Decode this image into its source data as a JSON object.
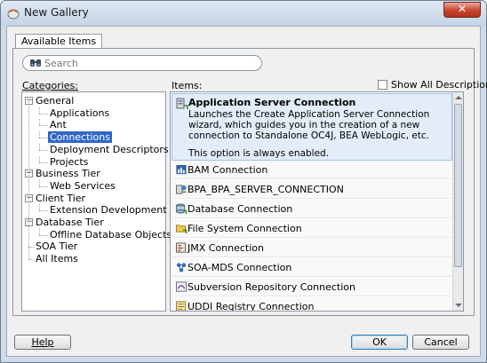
{
  "window": {
    "title": "New Gallery",
    "close_label": "✕"
  },
  "tabs": [
    {
      "label": "Available Items"
    }
  ],
  "search": {
    "placeholder": "Search",
    "value": ""
  },
  "categories": {
    "label": "Categories:",
    "tree": [
      {
        "label": "General",
        "level": 0,
        "expander": "−"
      },
      {
        "label": "Applications",
        "level": 1
      },
      {
        "label": "Ant",
        "level": 1
      },
      {
        "label": "Connections",
        "level": 1,
        "selected": true
      },
      {
        "label": "Deployment Descriptors",
        "level": 1
      },
      {
        "label": "Projects",
        "level": 1
      },
      {
        "label": "Business Tier",
        "level": 0,
        "expander": "−"
      },
      {
        "label": "Web Services",
        "level": 1
      },
      {
        "label": "Client Tier",
        "level": 0,
        "expander": "−"
      },
      {
        "label": "Extension Development",
        "level": 1
      },
      {
        "label": "Database Tier",
        "level": 0,
        "expander": "−"
      },
      {
        "label": "Offline Database Objects",
        "level": 1
      },
      {
        "label": "SOA Tier",
        "level": 0
      },
      {
        "label": "All Items",
        "level": 0
      }
    ]
  },
  "items": {
    "label": "Items:",
    "show_all_label": "Show All Descriptions",
    "show_all_checked": false,
    "selected": {
      "title": "Application Server Connection",
      "description": "Launches the Create Application Server Connection wizard, which guides you in the creation of a new connection to Standalone OC4J, BEA WebLogic, etc.",
      "note": "This option is always enabled.",
      "icon": "server-connection-icon"
    },
    "list": [
      {
        "label": "BAM Connection",
        "icon": "bam-icon"
      },
      {
        "label": "BPA_BPA_SERVER_CONNECTION",
        "icon": "bpa-icon"
      },
      {
        "label": "Database Connection",
        "icon": "database-icon"
      },
      {
        "label": "File System Connection",
        "icon": "file-system-icon"
      },
      {
        "label": "JMX Connection",
        "icon": "jmx-icon"
      },
      {
        "label": "SOA-MDS Connection",
        "icon": "soa-mds-icon"
      },
      {
        "label": "Subversion Repository Connection",
        "icon": "subversion-icon"
      },
      {
        "label": "UDDI Registry Connection",
        "icon": "uddi-icon"
      }
    ]
  },
  "buttons": {
    "help": "Help",
    "ok": "OK",
    "cancel": "Cancel"
  },
  "colors": {
    "selection": "#3168c6",
    "item_highlight": "#e2edf9"
  }
}
